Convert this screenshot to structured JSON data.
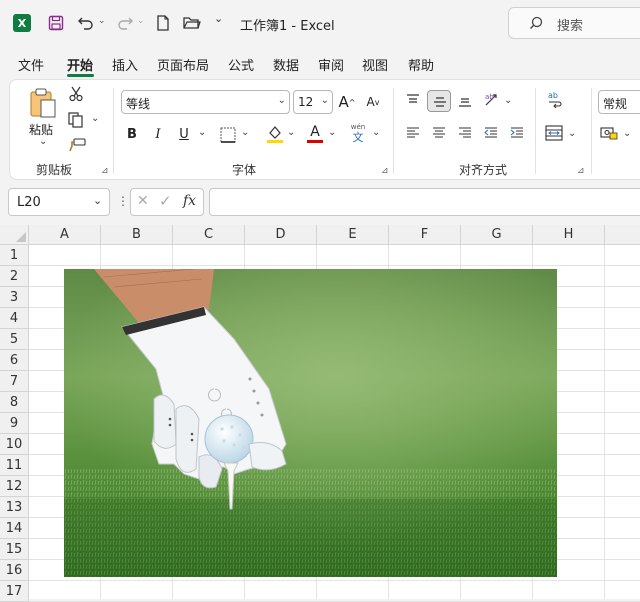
{
  "titlebar": {
    "doc_title": "工作簿1  -  Excel",
    "search_placeholder": "搜索",
    "app_logo": "X"
  },
  "menu": [
    "文件",
    "开始",
    "插入",
    "页面布局",
    "公式",
    "数据",
    "审阅",
    "视图",
    "帮助"
  ],
  "ribbon": {
    "clipboard": {
      "paste_label": "粘贴",
      "group_label": "剪贴板"
    },
    "font": {
      "font_name": "等线",
      "font_size": "12",
      "group_label": "字体",
      "bold": "B",
      "italic": "I",
      "underline": "U",
      "font_color_letter": "A",
      "phonetic_top": "wén",
      "phonetic_bottom": "文",
      "grow": "A",
      "shrink": "A"
    },
    "alignment": {
      "group_label": "对齐方式"
    },
    "number": {
      "format": "常规"
    },
    "colors": {
      "highlight": "#ffd800",
      "font_color": "#e00000",
      "accent": "#107c41"
    }
  },
  "formula_bar": {
    "cell_ref": "L20",
    "fx": "fx",
    "value": ""
  },
  "sheet": {
    "columns": [
      "A",
      "B",
      "C",
      "D",
      "E",
      "F",
      "G",
      "H"
    ],
    "rows": [
      "1",
      "2",
      "3",
      "4",
      "5",
      "6",
      "7",
      "8",
      "9",
      "10",
      "11",
      "12",
      "13",
      "14",
      "15",
      "16",
      "17"
    ]
  }
}
